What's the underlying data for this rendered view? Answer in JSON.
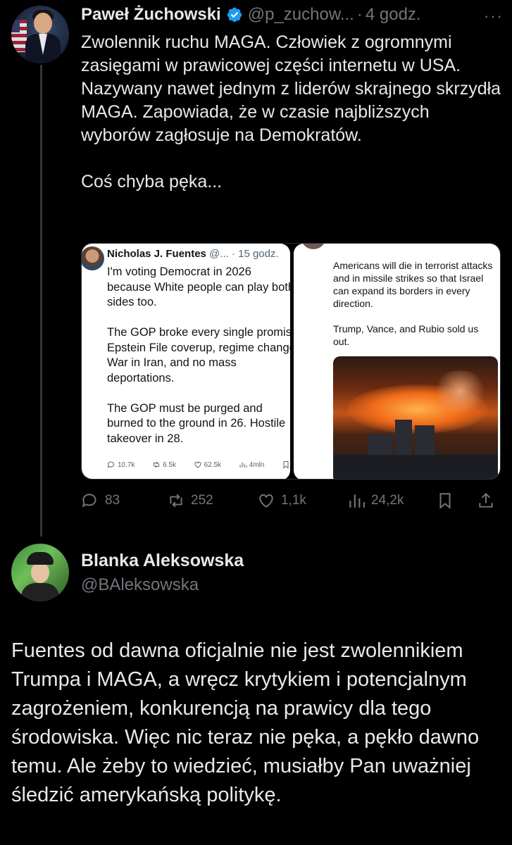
{
  "tweet": {
    "author_name": "Paweł Żuchowski",
    "author_handle": "@p_zuchow...",
    "separator": "·",
    "time": "4 godz.",
    "more": "···",
    "text_p1": "Zwolennik ruchu MAGA. Człowiek z ogromnymi zasięgami w prawicowej części internetu w USA. Nazywany nawet jednym z liderów skrajnego skrzydła MAGA. Zapowiada, że w czasie najbliższych wyborów zagłosuje na Demokratów.",
    "text_p2": "Coś chyba pęka...",
    "stats": {
      "replies": "83",
      "reposts": "252",
      "likes": "1,1k",
      "views": "24,2k"
    }
  },
  "embedded_left": {
    "author_name": "Nicholas J. Fuentes",
    "author_handle": "@...",
    "time": "· 15 godz.",
    "text": "I'm voting Democrat in 2026\nbecause White people can play both\nsides too.\n\nThe GOP broke every single promise.\nEpstein File coverup, regime change\nWar in Iran, and no mass\ndeportations.\n\nThe GOP must be purged and\nburned to the ground in 26. Hostile\ntakeover in 28.",
    "replies": "10.7k",
    "reposts": "6.5k",
    "likes": "62.5k",
    "views": "4mln"
  },
  "embedded_right": {
    "text": "Americans will die in terrorist attacks\nand in missile strikes so that Israel\ncan expand its borders in every\ndirection.\n\nTrump, Vance, and Rubio sold us\nout."
  },
  "reply": {
    "author_name": "Blanka Aleksowska",
    "author_handle": "@BAleksowska",
    "text": "Fuentes od dawna oficjalnie nie jest zwolennikiem Trumpa i MAGA, a wręcz krytykiem i potencjalnym zagrożeniem, konkurencją na prawicy dla tego środowiska. Więc nic teraz nie pęka, a pękło dawno temu. Ale żeby to wiedzieć, musiałby Pan uważniej śledzić amerykańską politykę."
  },
  "colors": {
    "background": "#000000",
    "text": "#e7e9ea",
    "muted": "#71767b",
    "verified": "#1d9bf0"
  },
  "icons": [
    "verified-badge-icon",
    "more-icon",
    "reply-icon",
    "repost-icon",
    "like-icon",
    "views-icon",
    "bookmark-icon",
    "share-icon"
  ]
}
